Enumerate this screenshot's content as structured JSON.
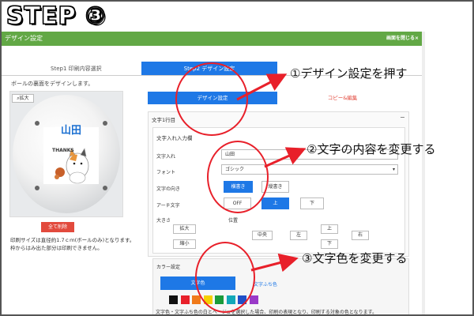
{
  "step": "STEP ③",
  "window": {
    "title": "デザイン設定",
    "close": "画面を閉じる×"
  },
  "steps": {
    "step1": "Step1 印刷内容選択",
    "step2": "Step2 デザイン設定"
  },
  "left": {
    "instruction": "ボールの裏面をデザインします。",
    "zoom": "拡大",
    "preview_name": "山田",
    "preview_thanks": "THANKS",
    "delete_all": "全て削除",
    "note_line1": "印刷サイズは直径約1.7ｃｍ(ボールのみ)となります。",
    "note_line2": "枠からはみ出た部分は印刷できません。"
  },
  "tabs": {
    "design": "デザイン設定",
    "copy": "コピー&編集"
  },
  "panel": {
    "title": "文字1行目",
    "section": "文字入れ入力欄",
    "text_label": "文字入れ",
    "text_value": "山田",
    "font_label": "フォント",
    "font_value": "ゴシック",
    "direction_label": "文字の向き",
    "horizontal": "横書き",
    "vertical": "縦書き",
    "arch_label": "アーチ文字",
    "arch_off": "OFF",
    "arch_up": "上",
    "arch_down": "下",
    "size_label": "大きさ",
    "enlarge": "拡大",
    "shrink": "縮小",
    "position_label": "位置",
    "center": "中央",
    "left": "左",
    "right": "右",
    "up": "上",
    "down": "下"
  },
  "color": {
    "title": "カラー設定",
    "text_color": "文字色",
    "outline_color": "文字ふち色",
    "swatches": [
      "#111111",
      "#e8202a",
      "#f07a1a",
      "#f5d000",
      "#1a9b3a",
      "#12a8b8",
      "#2050c8",
      "#9a3ac8"
    ],
    "note": "文字色・文字ふち色の白とベージュを選択した場合、印刷の表現となり、印刷する対象の色となります。"
  },
  "annotations": {
    "a1": "①デザイン設定を押す",
    "a2": "②文字の内容を変更する",
    "a3": "③文字色を変更する",
    "annotation_color": "#e8202a"
  }
}
